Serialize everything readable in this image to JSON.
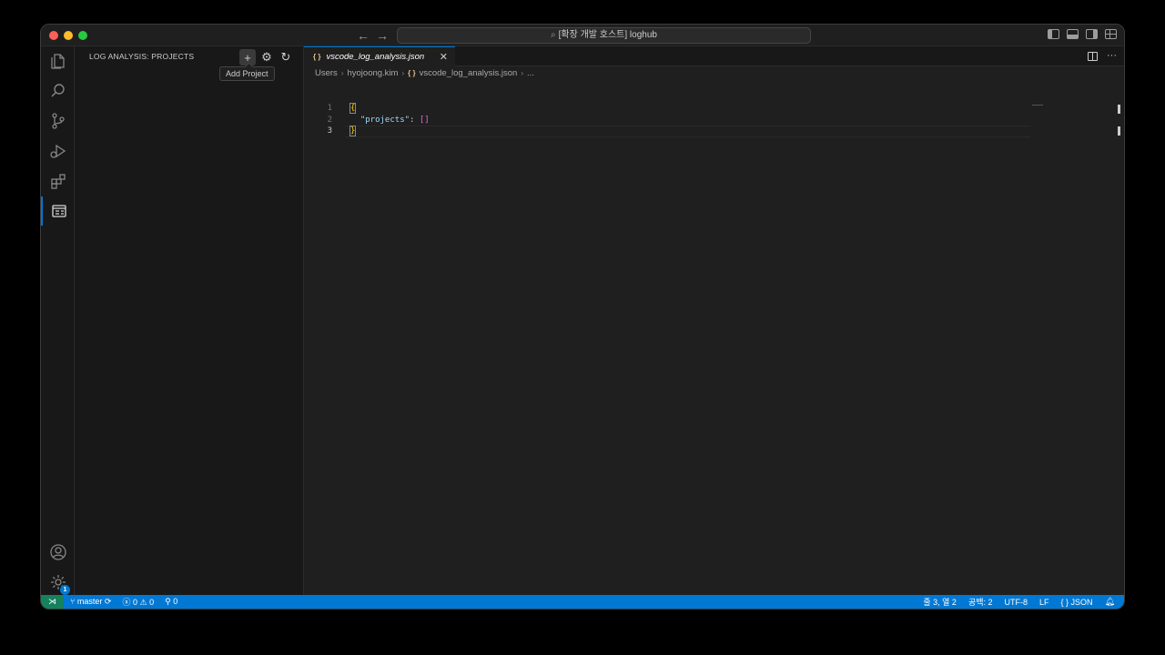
{
  "titlebar": {
    "command_center": "[확장 개발 호스트] loghub"
  },
  "sidebar": {
    "title": "LOG ANALYSIS: PROJECTS",
    "tooltip": "Add Project"
  },
  "editor": {
    "tab_label": "vscode_log_analysis.json",
    "breadcrumb": [
      "Users",
      "hyojoong.kim",
      "vscode_log_analysis.json",
      "..."
    ],
    "lines": [
      {
        "num": "1",
        "text": "{"
      },
      {
        "num": "2",
        "key": "\"projects\"",
        "colon": ": ",
        "value": "[]"
      },
      {
        "num": "3",
        "text": "}"
      }
    ]
  },
  "activity": {
    "settings_badge": "1"
  },
  "statusbar": {
    "branch": "master",
    "errors": "0",
    "warnings": "0",
    "ports": "0",
    "position": "줄 3, 열 2",
    "spaces": "공백: 2",
    "encoding": "UTF-8",
    "eol": "LF",
    "language": "JSON"
  }
}
